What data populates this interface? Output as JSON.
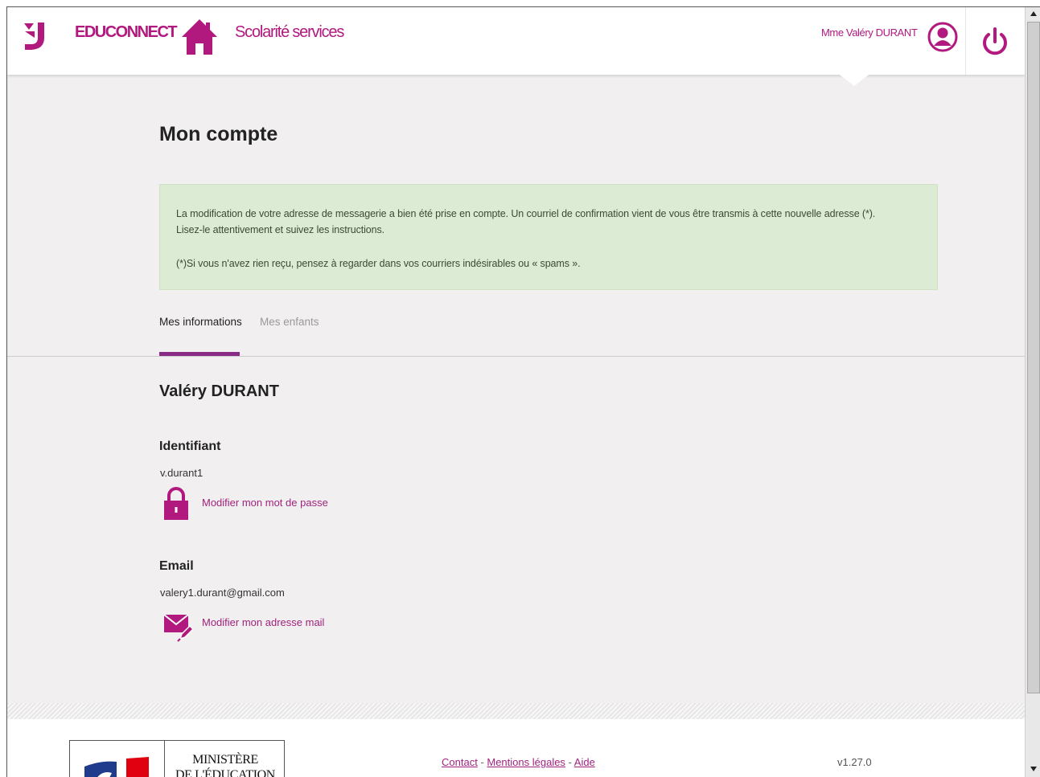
{
  "header": {
    "brand": "EDUCONNECT",
    "service": "Scolarité services",
    "user_name": "Mme Valéry DURANT"
  },
  "page": {
    "title": "Mon compte"
  },
  "alert": {
    "line1": "La modification de votre adresse de messagerie a bien été prise en compte. Un courriel de confirmation vient de vous être transmis à cette nouvelle adresse (*).",
    "line2": "Lisez-le attentivement et suivez les instructions.",
    "note": "(*)Si vous n'avez rien reçu, pensez à regarder dans vos courriers indésirables ou « spams »."
  },
  "tabs": [
    {
      "label": "Mes informations",
      "active": true
    },
    {
      "label": "Mes enfants",
      "active": false
    }
  ],
  "profile": {
    "full_name": "Valéry DURANT",
    "login_label": "Identifiant",
    "login_value": "v.durant1",
    "change_password": "Modifier mon mot de passe",
    "email_label": "Email",
    "email_value": "valery1.durant@gmail.com",
    "change_email": "Modifier mon adresse mail"
  },
  "footer": {
    "ministry_line1": "MINISTÈRE",
    "ministry_line2": "DE L'ÉDUCATION",
    "link_contact": "Contact",
    "link_legal": "Mentions légales",
    "link_help": "Aide",
    "version": "v1.27.0"
  },
  "colors": {
    "accent": "#b1197f",
    "tab_underline": "#8a2c86",
    "alert_bg": "#dcebd3",
    "page_bg": "#f1efef"
  }
}
